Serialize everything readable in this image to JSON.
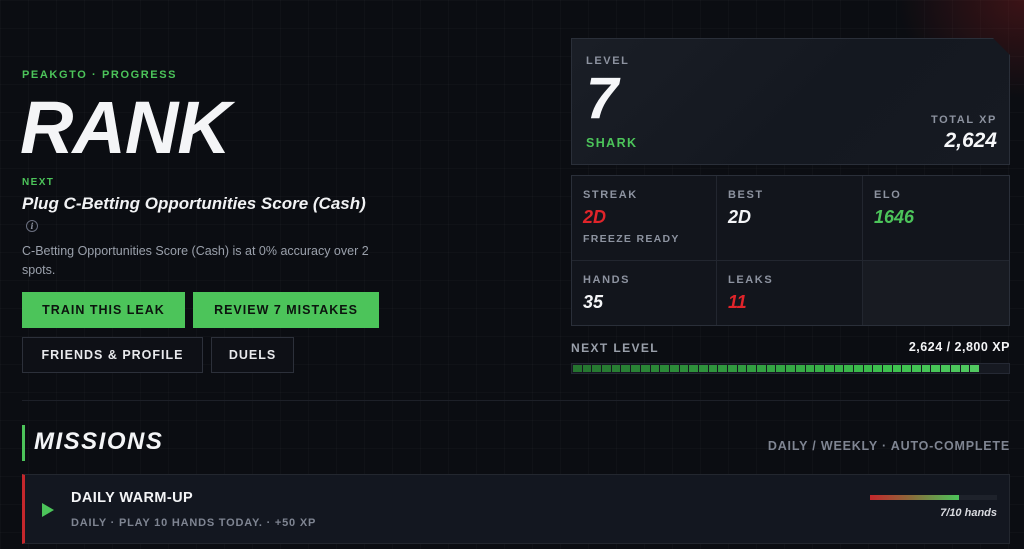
{
  "hero": {
    "eyebrow": "PEAKGTO · PROGRESS",
    "title": "RANK",
    "next_label": "NEXT",
    "next_title": "Plug C-Betting Opportunities Score (Cash)",
    "info_icon": "i",
    "next_desc": "C-Betting Opportunities Score (Cash) is at 0% accuracy over 2 spots."
  },
  "buttons": {
    "train": "TRAIN THIS LEAK",
    "review": "REVIEW 7 MISTAKES",
    "friends": "FRIENDS & PROFILE",
    "duels": "DUELS"
  },
  "level_card": {
    "label": "LEVEL",
    "level": "7",
    "tier": "SHARK",
    "xp_label": "TOTAL XP",
    "xp_value": "2,624"
  },
  "stats": {
    "streak_label": "STREAK",
    "streak_value": "2D",
    "streak_sub": "FREEZE READY",
    "best_label": "BEST",
    "best_value": "2D",
    "elo_label": "ELO",
    "elo_value": "1646",
    "hands_label": "HANDS",
    "hands_value": "35",
    "leaks_label": "LEAKS",
    "leaks_value": "11"
  },
  "next_level": {
    "label": "NEXT LEVEL",
    "value_text": "2,624 / 2,800 XP",
    "current": 2624,
    "target": 2800
  },
  "missions": {
    "title": "MISSIONS",
    "meta": "DAILY / WEEKLY · AUTO-COMPLETE",
    "items": [
      {
        "title": "DAILY WARM-UP",
        "desc": "DAILY · PLAY 10 HANDS TODAY. · +50 XP",
        "progress_text": "7/10 hands",
        "progress": 0.7
      }
    ]
  },
  "colors": {
    "accent_green": "#4cc45a",
    "alert_red": "#e0242a",
    "background": "#0b0d12"
  }
}
